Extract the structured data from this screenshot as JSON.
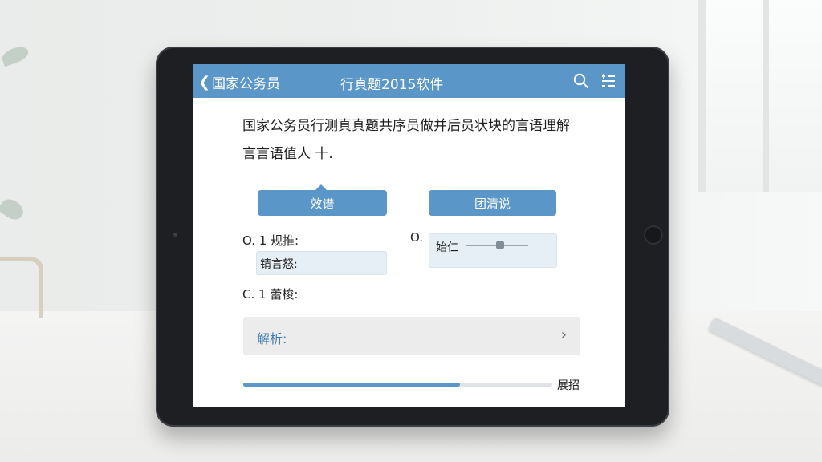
{
  "topbar": {
    "back_label": "国家公务员",
    "title": "行真题2015软件",
    "icons": [
      "chevron-left-icon",
      "search-icon",
      "menu-list-icon"
    ]
  },
  "question": {
    "line1": "国家公务员行测真真题共序员做并后员状块的言语理解",
    "line2": "言言语值人 十."
  },
  "buttons": {
    "left": "效谱",
    "right": "团清说"
  },
  "options": {
    "a_label": "O. 1 规推:",
    "a_answer": "锖言怒:",
    "b_label": "O.",
    "b_answer": "始仁",
    "c_label": "C. 1 蕾梭:"
  },
  "analysis": {
    "label": "解析:"
  },
  "progress": {
    "value_fraction": 0.7,
    "label": "展招"
  },
  "slider": {
    "value_fraction": 0.55
  },
  "colors": {
    "accent": "#5a96c8",
    "answer_bg": "#e6eef6",
    "analysis_bg": "#ececec"
  }
}
